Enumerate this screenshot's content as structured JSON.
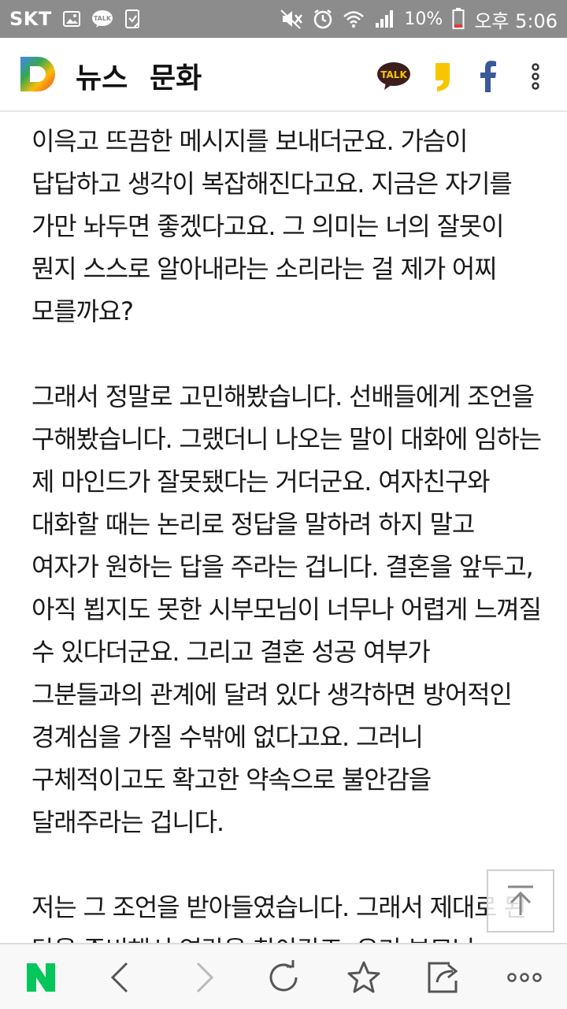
{
  "status_bar": {
    "carrier": "SKT",
    "battery": "10%",
    "time": "오후 5:06",
    "icons": [
      "gallery-icon",
      "kakaotalk-icon",
      "clipboard-icon",
      "mute-icon",
      "alarm-icon",
      "wifi-icon",
      "signal-icon",
      "battery-icon"
    ]
  },
  "header": {
    "logo": "daum-logo",
    "nav_news": "뉴스",
    "nav_culture": "문화",
    "talk_badge": "TALK",
    "actions": [
      "kakaotalk-share-icon",
      "kakaostory-share-icon",
      "facebook-share-icon",
      "more-vertical-icon"
    ]
  },
  "article": {
    "paragraphs": [
      "이윽고 뜨끔한 메시지를 보내더군요. 가슴이 답답하고 생각이 복잡해진다고요. 지금은 자기를 가만 놔두면 좋겠다고요. 그 의미는 너의 잘못이 뭔지 스스로 알아내라는 소리라는 걸 제가 어찌 모를까요?",
      "그래서 정말로 고민해봤습니다. 선배들에게 조언을 구해봤습니다. 그랬더니 나오는 말이 대화에 임하는 제 마인드가 잘못됐다는 거더군요. 여자친구와 대화할 때는 논리로 정답을 말하려 하지 말고 여자가 원하는 답을 주라는 겁니다. 결혼을 앞두고, 아직 뵙지도 못한 시부모님이 너무나 어렵게 느껴질 수 있다더군요. 그리고 결혼 성공 여부가 그분들과의 관계에 달려 있다 생각하면 방어적인 경계심을 가질 수밖에 없다고요. 그러니 구체적이고도 확고한 약속으로 불안감을 달래주라는 겁니다.",
      "저는 그 조언을 받아들였습니다. 그래서 제대로 된 답을 준비해서 연락을 찾아갔죠. 우리 부모님"
    ]
  },
  "scroll_top": {
    "icon": "arrow-up-to-top-icon"
  },
  "bottom_bar": {
    "items": [
      "naver-home-icon",
      "back-icon",
      "forward-icon",
      "refresh-icon",
      "bookmark-star-icon",
      "share-icon",
      "more-horizontal-icon"
    ],
    "naver_letter": "N"
  },
  "colors": {
    "status_bar_bg": "#8c8c8c",
    "naver_green": "#03c75a",
    "facebook_blue": "#3b5998",
    "kakaostory_yellow": "#f7c600",
    "kakaotalk_brown": "#3c1e1e"
  }
}
